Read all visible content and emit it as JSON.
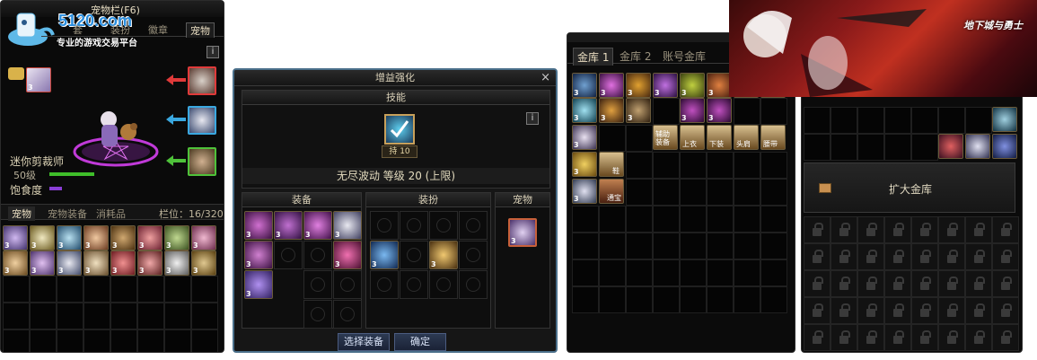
{
  "panel1": {
    "title": "宠物栏(F6)",
    "watermark_site": "5120.com",
    "watermark_slogan": "专业的游戏交易平台",
    "top_tabs": [
      "套",
      "装扮",
      "徽章",
      "宠物"
    ],
    "info_icon": "i",
    "pet_name": "迷你剪裁师",
    "pet_level": "50级",
    "satiety_label": "饱食度",
    "bottom_tabs": [
      "宠物",
      "宠物装备",
      "消耗品"
    ],
    "slot_count": "栏位：16/320",
    "item_level": "3"
  },
  "panel2": {
    "title": "增益强化",
    "close": "×",
    "skills_header": "技能",
    "info_icon": "i",
    "skill_tag": "持 10",
    "skill_line": "无尽波动 等级 20 (上限)",
    "sections": [
      "装备",
      "装扮",
      "宠物"
    ],
    "button_select": "选择装备",
    "button_confirm": "确定",
    "item_level": "3"
  },
  "panel3": {
    "tabs": [
      "金库 1",
      "金库 2",
      "账号金库"
    ],
    "item_labels": [
      "辅助装备",
      "上衣",
      "下装",
      "头肩",
      "腰带",
      "鞋",
      "通宝"
    ],
    "item_level": "3"
  },
  "panel4": {
    "expand_button": "扩大金库",
    "banner_logo": "地下城与勇士"
  },
  "colors": {
    "panel_bg": "#0d0d0d",
    "accent_gold": "#c8a05a",
    "green_bar": "#3fbf2a",
    "purple_bar": "#8a3fd6",
    "arrow_red": "#e03a3a",
    "arrow_blue": "#3aa8e0",
    "arrow_green": "#4ec23a"
  }
}
